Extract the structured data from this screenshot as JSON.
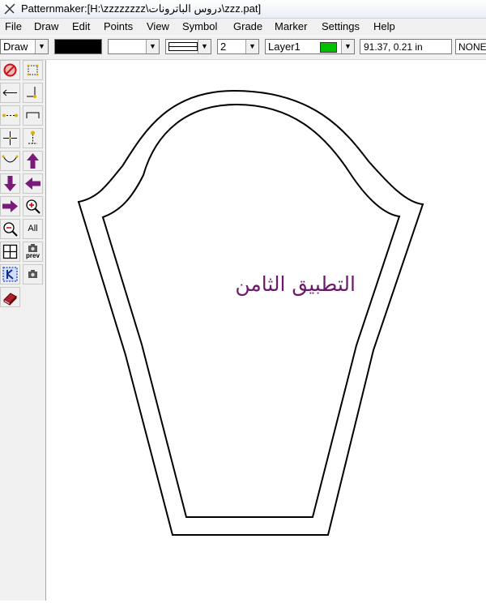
{
  "window": {
    "title": "Patternmaker:[H:\\zzzzzzzz\\دروس الباترونات\\zzz.pat]"
  },
  "menu": [
    "File",
    "Draw",
    "Edit",
    "Points",
    "View",
    "Symbol",
    "Grade",
    "Marker",
    "Settings",
    "Help"
  ],
  "toolbar": {
    "mode": "Draw",
    "line_width": "2",
    "layer": "Layer1",
    "layer_color": "#00c000",
    "line_color": "#000000",
    "coordinates": "91.37, 0.21 in",
    "snap": "NONE"
  },
  "tools": [
    {
      "icon": "no-entry-icon"
    },
    {
      "icon": "dotted-grid-icon"
    },
    {
      "icon": "line-arrow-icon"
    },
    {
      "icon": "point-line-icon"
    },
    {
      "icon": "dotted-line-icon"
    },
    {
      "icon": "bracket-line-icon"
    },
    {
      "icon": "cross-icon"
    },
    {
      "icon": "point-move-icon"
    },
    {
      "icon": "curve-icon"
    },
    {
      "icon": "arrow-up-icon"
    },
    {
      "icon": "arrow-down-icon"
    },
    {
      "icon": "arrow-left-icon"
    },
    {
      "icon": "arrow-right-icon"
    },
    {
      "icon": "zoom-in-icon"
    },
    {
      "icon": "zoom-out-icon"
    },
    {
      "icon": "zoom-all-icon",
      "label": "All"
    },
    {
      "icon": "grid-icon"
    },
    {
      "icon": "preview-icon",
      "label": "prev"
    },
    {
      "icon": "select-icon"
    },
    {
      "icon": "camera-icon"
    },
    {
      "icon": "book-icon"
    }
  ],
  "canvas": {
    "label": "التطبيق الثامن"
  }
}
